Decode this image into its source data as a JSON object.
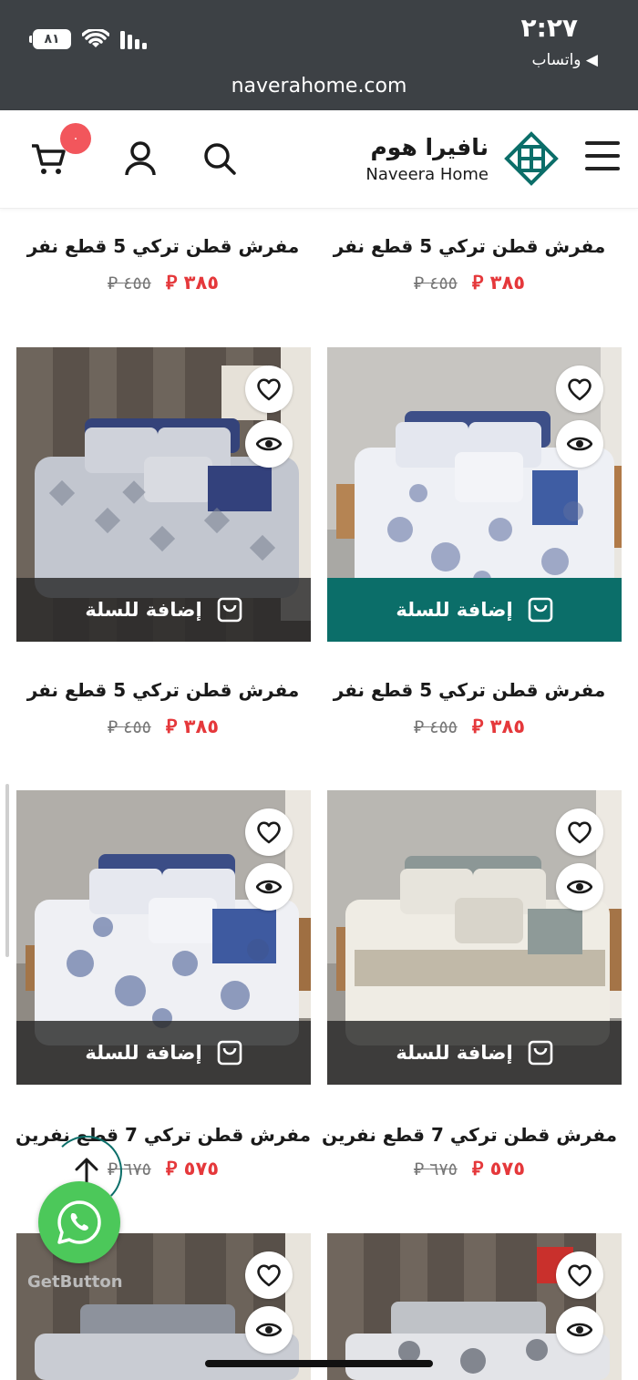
{
  "status_bar": {
    "time": "٢:٢٧",
    "back_app": "◀ واتساب",
    "battery": "٨١"
  },
  "browser": {
    "url": "naverahome.com"
  },
  "header": {
    "logo_ar": "نافيرا هوم",
    "logo_en": "Naveera Home",
    "cart_count": "٠"
  },
  "colors": {
    "accent": "#0b6e69",
    "sale": "#e5383b",
    "whatsapp": "#4cc85a",
    "badge": "#f2565c"
  },
  "add_to_cart_label": "إضافة للسلة",
  "rows": [
    {
      "right": {
        "title": "مفرش قطن تركي 5 قطع نفر",
        "price_new": "٣٨٥ ⃁",
        "price_old": "٤٥٥ ⃁"
      },
      "left": {
        "title": "مفرش قطن تركي 5 قطع نفر",
        "price_new": "٣٨٥ ⃁",
        "price_old": "٤٥٥ ⃁"
      }
    },
    {
      "right": {
        "title": "مفرش قطن تركي 5 قطع نفر",
        "price_new": "٣٨٥ ⃁",
        "price_old": "٤٥٥ ⃁"
      },
      "left": {
        "title": "مفرش قطن تركي 5 قطع نفر",
        "price_new": "٣٨٥ ⃁",
        "price_old": "٤٥٥ ⃁"
      }
    },
    {
      "right": {
        "title": "مفرش قطن تركي 7 قطع نفرين",
        "price_new": "٥٧٥ ⃁",
        "price_old": "٦٧٥ ⃁"
      },
      "left": {
        "title": "مفرش قطن تركي 7 قطع نفرين",
        "price_new": "٥٧٥ ⃁",
        "price_old": "٦٧٥ ⃁"
      }
    }
  ],
  "getbutton": "GetButton"
}
